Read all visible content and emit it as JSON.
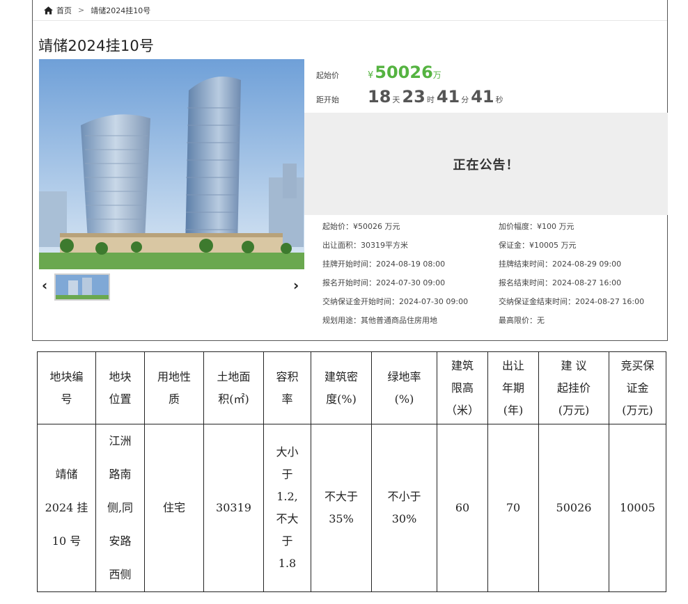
{
  "breadcrumb": {
    "home": "首页",
    "separator": ">",
    "current": "靖储2024挂10号"
  },
  "title": "靖储2024挂10号",
  "price": {
    "label": "起始价",
    "currency": "¥",
    "value": "50026",
    "unit": "万"
  },
  "countdown": {
    "label": "距开始",
    "days": "18",
    "days_unit": "天",
    "hours": "23",
    "hours_unit": "时",
    "minutes": "41",
    "minutes_unit": "分",
    "seconds": "41",
    "seconds_unit": "秒"
  },
  "notice": "正在公告！",
  "details": {
    "start_price": "起始价：¥50026 万元",
    "increment": "加价幅度：¥100 万元",
    "area": "出让面积：30319平方米",
    "deposit": "保证金：¥10005 万元",
    "listing_start": "挂牌开始时间：2024-08-19 08:00",
    "listing_end": "挂牌结束时间：2024-08-29 09:00",
    "signup_start": "报名开始时间：2024-07-30 09:00",
    "signup_end": "报名结束时间：2024-08-27 16:00",
    "deposit_start": "交纳保证金开始时间：2024-07-30 09:00",
    "deposit_end": "交纳保证金结束时间：2024-08-27 16:00",
    "usage": "规划用途：其他普通商品住房用地",
    "max_price": "最高限价：无"
  },
  "table": {
    "headers": {
      "h0": [
        "地块编",
        "号"
      ],
      "h1": [
        "地块",
        "位置"
      ],
      "h2": [
        "用地性",
        "质"
      ],
      "h3": [
        "土地面",
        "积(㎡)"
      ],
      "h4": [
        "容积",
        "率"
      ],
      "h5": [
        "建筑密",
        "度(%)"
      ],
      "h6": [
        "绿地率",
        "(%)"
      ],
      "h7": [
        "建筑",
        "限高",
        "（米）"
      ],
      "h8": [
        "出让",
        "年期",
        "(年)"
      ],
      "h9": [
        "建 议",
        "起挂价",
        "(万元)"
      ],
      "h10": [
        "竞买保",
        "证金",
        "(万元)"
      ]
    },
    "row": {
      "c0": [
        "靖储",
        "2024 挂",
        "10 号"
      ],
      "c1": [
        "江洲",
        "路南",
        "侧,同",
        "安路",
        "西侧"
      ],
      "c2": "住宅",
      "c3": "30319",
      "c4": [
        "大小",
        "于",
        "1.2,",
        "不大",
        "于",
        "1.8"
      ],
      "c5": [
        "不大于",
        "35%"
      ],
      "c6": [
        "不小于",
        "30%"
      ],
      "c7": "60",
      "c8": "70",
      "c9": "50026",
      "c10": "10005"
    }
  },
  "colors": {
    "accent_green": "#55b341",
    "notice_bg": "#eeeeee"
  },
  "icons": [
    "home-icon",
    "chevron-left-icon",
    "chevron-right-icon"
  ]
}
